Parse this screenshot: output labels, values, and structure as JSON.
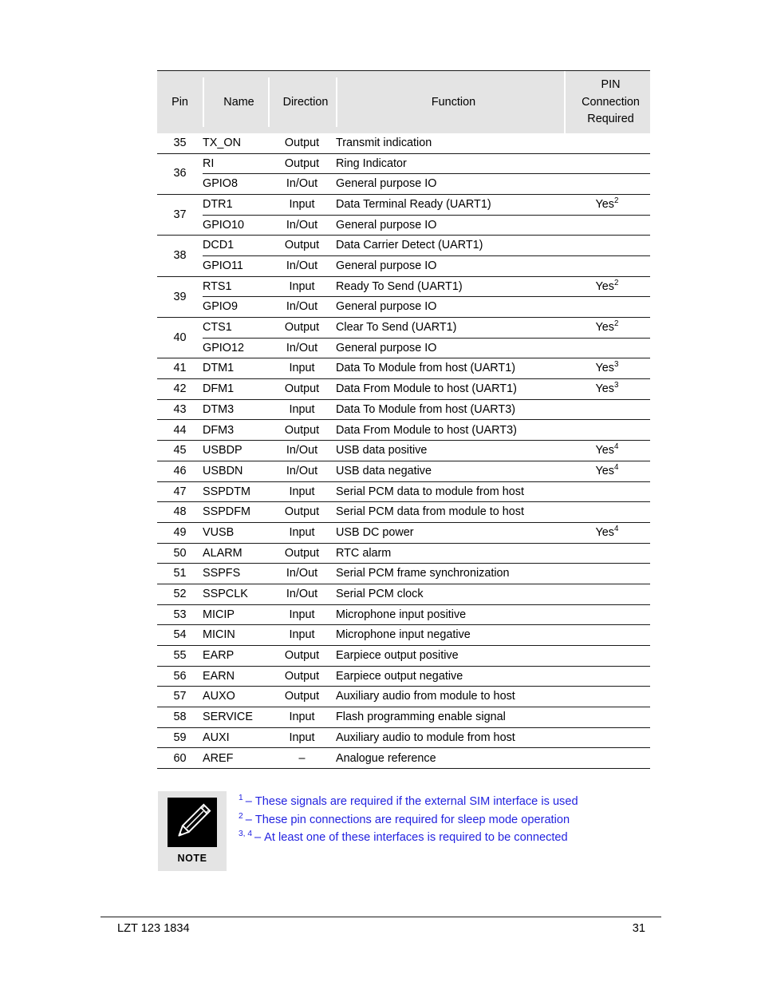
{
  "document": {
    "footer": {
      "doc_number": "LZT 123 1834",
      "page_number": "31"
    }
  },
  "table": {
    "headers": {
      "pin": "Pin",
      "name": "Name",
      "direction": "Direction",
      "function": "Function",
      "required_line1": "PIN",
      "required_line2": "Connection",
      "required_line3": "Required"
    },
    "groups": [
      {
        "pin": "35",
        "rows": [
          {
            "name": "TX_ON",
            "direction": "Output",
            "function": "Transmit indication",
            "required": "",
            "required_sup": ""
          }
        ]
      },
      {
        "pin": "36",
        "rows": [
          {
            "name": "RI",
            "direction": "Output",
            "function": "Ring Indicator",
            "required": "",
            "required_sup": ""
          },
          {
            "name": "GPIO8",
            "direction": "In/Out",
            "function": "General purpose IO",
            "required": "",
            "required_sup": ""
          }
        ]
      },
      {
        "pin": "37",
        "rows": [
          {
            "name": "DTR1",
            "direction": "Input",
            "function": "Data Terminal Ready (UART1)",
            "required": "Yes",
            "required_sup": "2"
          },
          {
            "name": "GPIO10",
            "direction": "In/Out",
            "function": "General purpose IO",
            "required": "",
            "required_sup": ""
          }
        ]
      },
      {
        "pin": "38",
        "rows": [
          {
            "name": "DCD1",
            "direction": "Output",
            "function": "Data Carrier Detect (UART1)",
            "required": "",
            "required_sup": ""
          },
          {
            "name": "GPIO11",
            "direction": "In/Out",
            "function": "General purpose IO",
            "required": "",
            "required_sup": ""
          }
        ]
      },
      {
        "pin": "39",
        "rows": [
          {
            "name": "RTS1",
            "direction": "Input",
            "function": "Ready To Send (UART1)",
            "required": "Yes",
            "required_sup": "2"
          },
          {
            "name": "GPIO9",
            "direction": "In/Out",
            "function": "General purpose IO",
            "required": "",
            "required_sup": ""
          }
        ]
      },
      {
        "pin": "40",
        "rows": [
          {
            "name": "CTS1",
            "direction": "Output",
            "function": "Clear To Send (UART1)",
            "required": "Yes",
            "required_sup": "2"
          },
          {
            "name": "GPIO12",
            "direction": "In/Out",
            "function": "General purpose IO",
            "required": "",
            "required_sup": ""
          }
        ]
      },
      {
        "pin": "41",
        "rows": [
          {
            "name": "DTM1",
            "direction": "Input",
            "function": "Data To Module from host (UART1)",
            "required": "Yes",
            "required_sup": "3"
          }
        ]
      },
      {
        "pin": "42",
        "rows": [
          {
            "name": "DFM1",
            "direction": "Output",
            "function": "Data From Module to host (UART1)",
            "required": "Yes",
            "required_sup": "3"
          }
        ]
      },
      {
        "pin": "43",
        "rows": [
          {
            "name": "DTM3",
            "direction": "Input",
            "function": "Data To Module from host (UART3)",
            "required": "",
            "required_sup": ""
          }
        ]
      },
      {
        "pin": "44",
        "rows": [
          {
            "name": "DFM3",
            "direction": "Output",
            "function": "Data From Module to host (UART3)",
            "required": "",
            "required_sup": ""
          }
        ]
      },
      {
        "pin": "45",
        "rows": [
          {
            "name": "USBDP",
            "direction": "In/Out",
            "function": "USB data positive",
            "required": "Yes",
            "required_sup": "4"
          }
        ]
      },
      {
        "pin": "46",
        "rows": [
          {
            "name": "USBDN",
            "direction": "In/Out",
            "function": "USB data negative",
            "required": "Yes",
            "required_sup": "4"
          }
        ]
      },
      {
        "pin": "47",
        "rows": [
          {
            "name": "SSPDTM",
            "direction": "Input",
            "function": "Serial PCM data to module from host",
            "required": "",
            "required_sup": ""
          }
        ]
      },
      {
        "pin": "48",
        "rows": [
          {
            "name": "SSPDFM",
            "direction": "Output",
            "function": "Serial PCM data from module to host",
            "required": "",
            "required_sup": ""
          }
        ]
      },
      {
        "pin": "49",
        "rows": [
          {
            "name": "VUSB",
            "direction": "Input",
            "function": "USB DC power",
            "required": "Yes",
            "required_sup": "4"
          }
        ]
      },
      {
        "pin": "50",
        "rows": [
          {
            "name": "ALARM",
            "direction": "Output",
            "function": "RTC alarm",
            "required": "",
            "required_sup": ""
          }
        ]
      },
      {
        "pin": "51",
        "rows": [
          {
            "name": "SSPFS",
            "direction": "In/Out",
            "function": "Serial PCM frame synchronization",
            "required": "",
            "required_sup": ""
          }
        ]
      },
      {
        "pin": "52",
        "rows": [
          {
            "name": "SSPCLK",
            "direction": "In/Out",
            "function": "Serial PCM clock",
            "required": "",
            "required_sup": ""
          }
        ]
      },
      {
        "pin": "53",
        "rows": [
          {
            "name": "MICIP",
            "direction": "Input",
            "function": "Microphone input positive",
            "required": "",
            "required_sup": ""
          }
        ]
      },
      {
        "pin": "54",
        "rows": [
          {
            "name": "MICIN",
            "direction": "Input",
            "function": "Microphone input negative",
            "required": "",
            "required_sup": ""
          }
        ]
      },
      {
        "pin": "55",
        "rows": [
          {
            "name": "EARP",
            "direction": "Output",
            "function": "Earpiece output positive",
            "required": "",
            "required_sup": ""
          }
        ]
      },
      {
        "pin": "56",
        "rows": [
          {
            "name": "EARN",
            "direction": "Output",
            "function": "Earpiece output negative",
            "required": "",
            "required_sup": ""
          }
        ]
      },
      {
        "pin": "57",
        "rows": [
          {
            "name": "AUXO",
            "direction": "Output",
            "function": "Auxiliary audio from module to host",
            "required": "",
            "required_sup": ""
          }
        ]
      },
      {
        "pin": "58",
        "rows": [
          {
            "name": "SERVICE",
            "direction": "Input",
            "function": "Flash programming enable signal",
            "required": "",
            "required_sup": ""
          }
        ]
      },
      {
        "pin": "59",
        "rows": [
          {
            "name": "AUXI",
            "direction": "Input",
            "function": "Auxiliary audio to module from host",
            "required": "",
            "required_sup": ""
          }
        ]
      },
      {
        "pin": "60",
        "rows": [
          {
            "name": "AREF",
            "direction": "–",
            "function": "Analogue reference",
            "required": "",
            "required_sup": ""
          }
        ]
      }
    ]
  },
  "note": {
    "badge_label": "NOTE",
    "icon": "pencil-icon",
    "text_color": "#2323e0",
    "lines": [
      {
        "mark": "1",
        "dash": "–",
        "text": "These signals are required if the external SIM interface is used"
      },
      {
        "mark": "2",
        "dash": "–",
        "text": "These pin connections are required for sleep mode operation"
      },
      {
        "mark": "3, 4",
        "dash": "–",
        "text": "At least one of these interfaces is required to be connected"
      }
    ]
  }
}
